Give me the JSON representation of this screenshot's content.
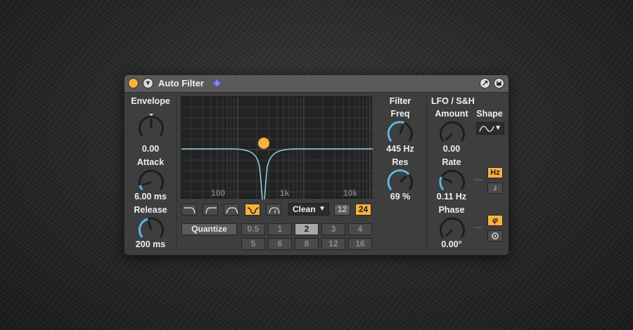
{
  "device": {
    "title": "Auto Filter",
    "envelope": {
      "section_label": "Envelope",
      "amount_value": "0.00",
      "attack_label": "Attack",
      "attack_value": "6.00 ms",
      "release_label": "Release",
      "release_value": "200 ms"
    },
    "display": {
      "freq_ticks": [
        "100",
        "1k",
        "10k"
      ]
    },
    "filter_types": [
      "lowpass",
      "highpass",
      "bandpass",
      "notch",
      "morph"
    ],
    "selected_filter_type": "notch",
    "circuit": {
      "value": "Clean"
    },
    "slope_buttons": [
      {
        "label": "12",
        "active": false
      },
      {
        "label": "24",
        "active": true
      }
    ],
    "quantize": {
      "label": "Quantize",
      "row1": [
        "0.5",
        "1",
        "2",
        "3",
        "4"
      ],
      "row2": [
        "5",
        "6",
        "8",
        "12",
        "16"
      ],
      "selected": "2"
    },
    "filter": {
      "section_label": "Filter",
      "freq_label": "Freq",
      "freq_value": "445 Hz",
      "res_label": "Res",
      "res_value": "69 %"
    },
    "lfo": {
      "section_label": "LFO / S&H",
      "amount_label": "Amount",
      "amount_value": "0.00",
      "shape_label": "Shape",
      "rate_label": "Rate",
      "rate_value": "0.11 Hz",
      "rate_mode_hz": "Hz",
      "rate_mode_sync": "♪",
      "phase_label": "Phase",
      "phase_value": "0.00°",
      "phase_mode": "φ"
    }
  },
  "colors": {
    "accent": "#f6b13e",
    "curve": "#8ccbe6",
    "knob_arc": "#5fb7e6",
    "panel": "#3e3e3e"
  }
}
